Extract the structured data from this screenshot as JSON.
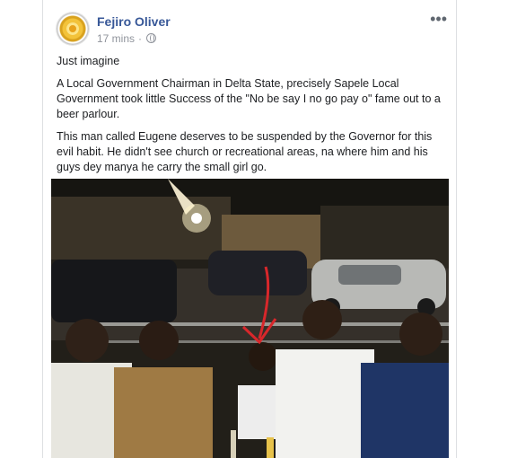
{
  "post": {
    "author": "Fejiro Oliver",
    "time": "17 mins",
    "audience_icon": "globe-icon",
    "menu_icon": "more-horizontal-icon",
    "paragraphs": [
      "Just imagine",
      "A Local Government Chairman in Delta State, precisely Sapele Local Government took little Success of the \"No be say I no go pay o\" fame out to a beer parlour.",
      "This man called Eugene deserves to be suspended by the Governor for this evil habit. He didn't see church or recreational areas, na where him and his guys dey manya he carry the small girl go."
    ]
  },
  "colors": {
    "author_link": "#385898",
    "meta_text": "#90949c",
    "arrow": "#d8272b"
  }
}
